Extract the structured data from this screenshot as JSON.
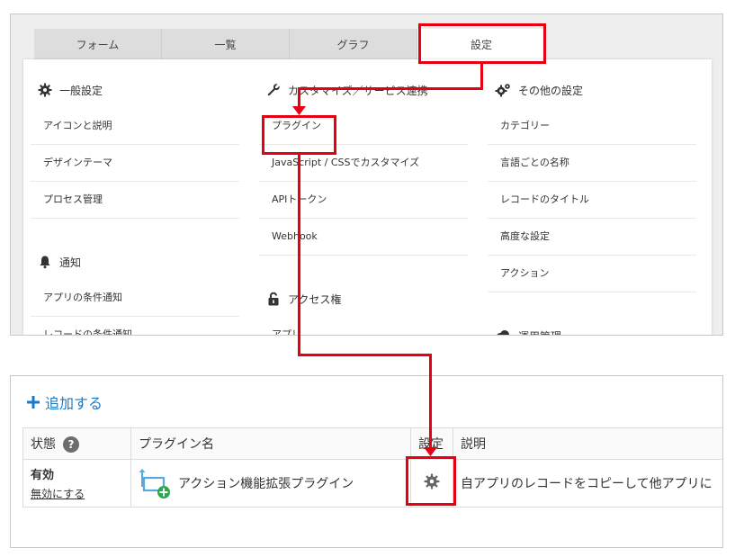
{
  "tabs": [
    {
      "label": "フォーム"
    },
    {
      "label": "一覧"
    },
    {
      "label": "グラフ"
    },
    {
      "label": "設定"
    }
  ],
  "general": {
    "title": "一般設定",
    "items": [
      "アイコンと説明",
      "デザインテーマ",
      "プロセス管理"
    ]
  },
  "notice": {
    "title": "通知",
    "items": [
      "アプリの条件通知",
      "レコードの条件通知"
    ]
  },
  "customize": {
    "title": "カスタマイズ／サービス連携",
    "items": [
      "プラグイン",
      "JavaScript / CSSでカスタマイズ",
      "APIトークン",
      "Webhook"
    ]
  },
  "access": {
    "title": "アクセス権",
    "items": [
      "アプリ"
    ]
  },
  "other": {
    "title": "その他の設定",
    "items": [
      "カテゴリー",
      "言語ごとの名称",
      "レコードのタイトル",
      "高度な設定",
      "アクション"
    ]
  },
  "operation": {
    "title": "運用管理"
  },
  "plugin_list": {
    "add_label": "追加する",
    "headers": {
      "status": "状態",
      "help": "?",
      "name": "プラグイン名",
      "setting": "設定",
      "description": "説明"
    },
    "rows": [
      {
        "status": "有効",
        "disable_link": "無効にする",
        "name": "アクション機能拡張プラグイン",
        "description": "自アプリのレコードをコピーして他アプリに"
      }
    ]
  },
  "colors": {
    "annotation": "#e60012",
    "link": "#1a7ac8",
    "plugin_icon_blue": "#5aa9dd",
    "plugin_icon_green": "#2ea84a"
  }
}
